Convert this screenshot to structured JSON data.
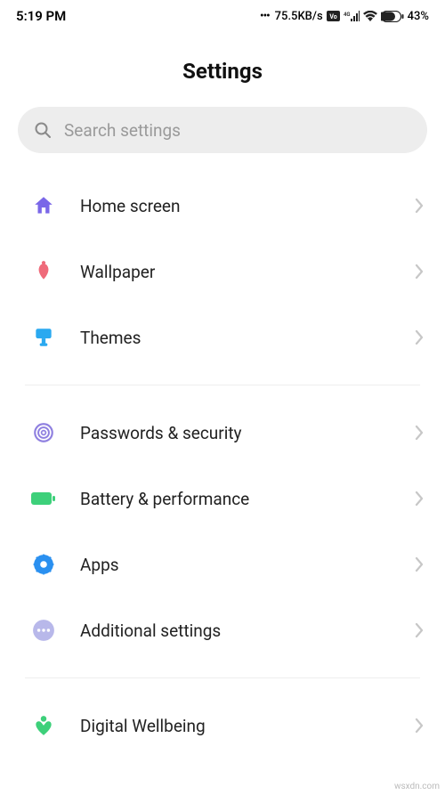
{
  "statusBar": {
    "time": "5:19 PM",
    "netSpeed": "75.5KB/s",
    "batteryPercent": "43%"
  },
  "header": {
    "title": "Settings"
  },
  "search": {
    "placeholder": "Search settings"
  },
  "group1": [
    {
      "icon": "home-icon",
      "label": "Home screen",
      "color": "#7a67e8"
    },
    {
      "icon": "wallpaper-icon",
      "label": "Wallpaper",
      "color": "#ef6a7a"
    },
    {
      "icon": "themes-icon",
      "label": "Themes",
      "color": "#2aa9f0"
    }
  ],
  "group2": [
    {
      "icon": "fingerprint-icon",
      "label": "Passwords & security",
      "color": "#8f80e0"
    },
    {
      "icon": "battery-icon",
      "label": "Battery & performance",
      "color": "#3dd07a"
    },
    {
      "icon": "apps-icon",
      "label": "Apps",
      "color": "#2a90f0"
    },
    {
      "icon": "additional-icon",
      "label": "Additional settings",
      "color": "#9d9de2"
    }
  ],
  "group3": [
    {
      "icon": "wellbeing-icon",
      "label": "Digital Wellbeing",
      "color": "#3dd07a"
    }
  ],
  "watermark": "wsxdn.com"
}
